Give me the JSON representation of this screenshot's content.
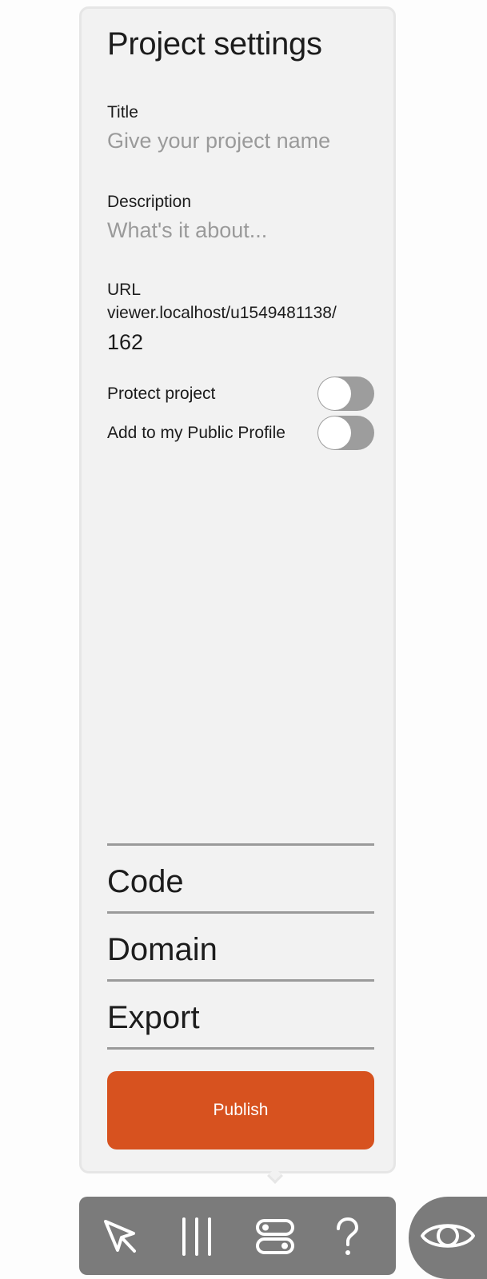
{
  "panel": {
    "title": "Project settings",
    "title_field": {
      "label": "Title",
      "placeholder": "Give your project name",
      "value": ""
    },
    "description_field": {
      "label": "Description",
      "placeholder": "What's it about...",
      "value": ""
    },
    "url_field": {
      "label": "URL",
      "base": "viewer.localhost/u1549481138/",
      "id": "162"
    },
    "toggles": [
      {
        "label": "Protect project",
        "on": false
      },
      {
        "label": "Add to my Public Profile",
        "on": false
      }
    ],
    "sections": [
      "Code",
      "Domain",
      "Export"
    ],
    "publish_label": "Publish"
  },
  "toolbar": {
    "tools": [
      {
        "icon": "pointer-icon"
      },
      {
        "icon": "columns-icon"
      },
      {
        "icon": "toggles-icon"
      },
      {
        "icon": "help-icon"
      }
    ],
    "preview_icon": "eye-icon"
  },
  "colors": {
    "panel_bg": "#f2f2f2",
    "accent": "#d7521f",
    "toolbar_bg": "#7b7b7b",
    "toggle_off": "#9d9d9d",
    "placeholder": "#9a9a9a"
  }
}
